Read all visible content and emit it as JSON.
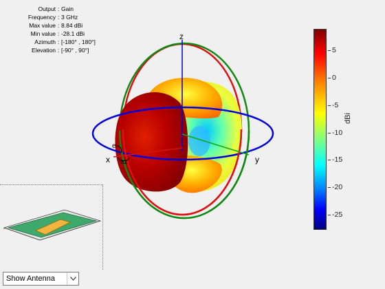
{
  "info": [
    {
      "key": "Output",
      "value": "Gain"
    },
    {
      "key": "Frequency",
      "value": "3 GHz"
    },
    {
      "key": "Max value",
      "value": "8.84 dBi"
    },
    {
      "key": "Min value",
      "value": "-28.1 dBi"
    },
    {
      "key": "Azimuth",
      "value": "[-180° , 180°]"
    },
    {
      "key": "Elevation",
      "value": "[-90° , 90°]"
    }
  ],
  "axes": {
    "x": "x",
    "y": "y",
    "z": "z",
    "el": "el",
    "az": "az"
  },
  "colorbar": {
    "label": "dBi",
    "ticks": [
      "5",
      "0",
      "-5",
      "-10",
      "-15",
      "-20",
      "-25"
    ],
    "colors": {
      "max": "#7f0000",
      "mid": "#ffff00",
      "min": "#00007f"
    }
  },
  "dropdown": {
    "selected": "Show Antenna"
  },
  "ring_colors": {
    "azimuth": "#0000dd",
    "elevation_xz": "#dd1111",
    "elevation_yz": "#118811"
  }
}
